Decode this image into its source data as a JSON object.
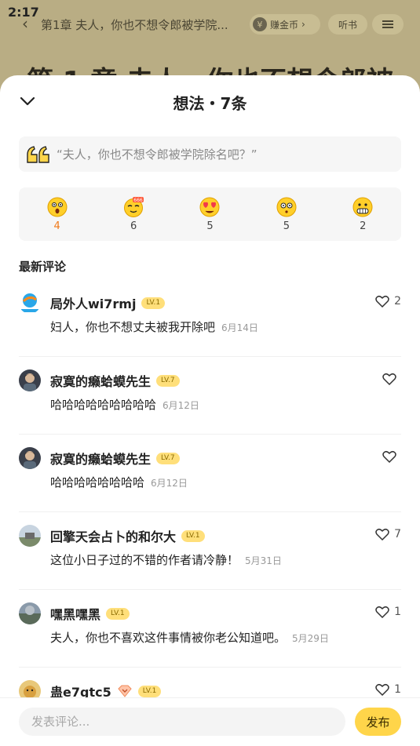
{
  "status_bar": {
    "time": "2:17"
  },
  "reader": {
    "chapter_short": "第1章 夫人，你也不想令郎被学院...",
    "earn_coins": "赚金币",
    "listen": "听书",
    "chapter_title": "第 1 章 夫人，你也不想令郎被"
  },
  "sheet": {
    "title": "想法・7条",
    "quote": "“夫人，你也不想令郎被学院除名吧？”",
    "reactions": [
      {
        "icon": "surprised-face-icon",
        "count": "4",
        "active": true
      },
      {
        "icon": "666-face-icon",
        "count": "6",
        "active": false
      },
      {
        "icon": "heart-eyes-face-icon",
        "count": "5",
        "active": false
      },
      {
        "icon": "dizzy-face-icon",
        "count": "5",
        "active": false
      },
      {
        "icon": "grimace-face-icon",
        "count": "2",
        "active": false
      }
    ],
    "section_title": "最新评论",
    "comments": [
      {
        "user": "局外人wi7rmj",
        "level": "LV.1",
        "text": "妇人，你也不想丈夫被我开除吧",
        "date": "6月14日",
        "likes": "2"
      },
      {
        "user": "寂寞的癞蛤蟆先生",
        "level": "LV.7",
        "text": "哈哈哈哈哈哈哈哈哈",
        "date": "6月12日",
        "likes": ""
      },
      {
        "user": "寂寞的癞蛤蟆先生",
        "level": "LV.7",
        "text": "哈哈哈哈哈哈哈哈",
        "date": "6月12日",
        "likes": ""
      },
      {
        "user": "回擎天会占卜的和尔大",
        "level": "LV.1",
        "text": "这位小日子过的不错的作者请冷静！",
        "date": "5月31日",
        "likes": "7"
      },
      {
        "user": "嘿黑嘿黑",
        "level": "LV.1",
        "text": "夫人，你也不喜欢这件事情被你老公知道吧。",
        "date": "5月29日",
        "likes": "1"
      },
      {
        "user": "蛊e7gtc5",
        "level": "LV.1",
        "text": "",
        "date": "",
        "likes": "1"
      }
    ]
  },
  "composer": {
    "placeholder": "发表评论...",
    "publish": "发布"
  },
  "colors": {
    "accent": "#ffd54a",
    "active_count": "#f07a1a",
    "overlay": "#b9ad84"
  }
}
